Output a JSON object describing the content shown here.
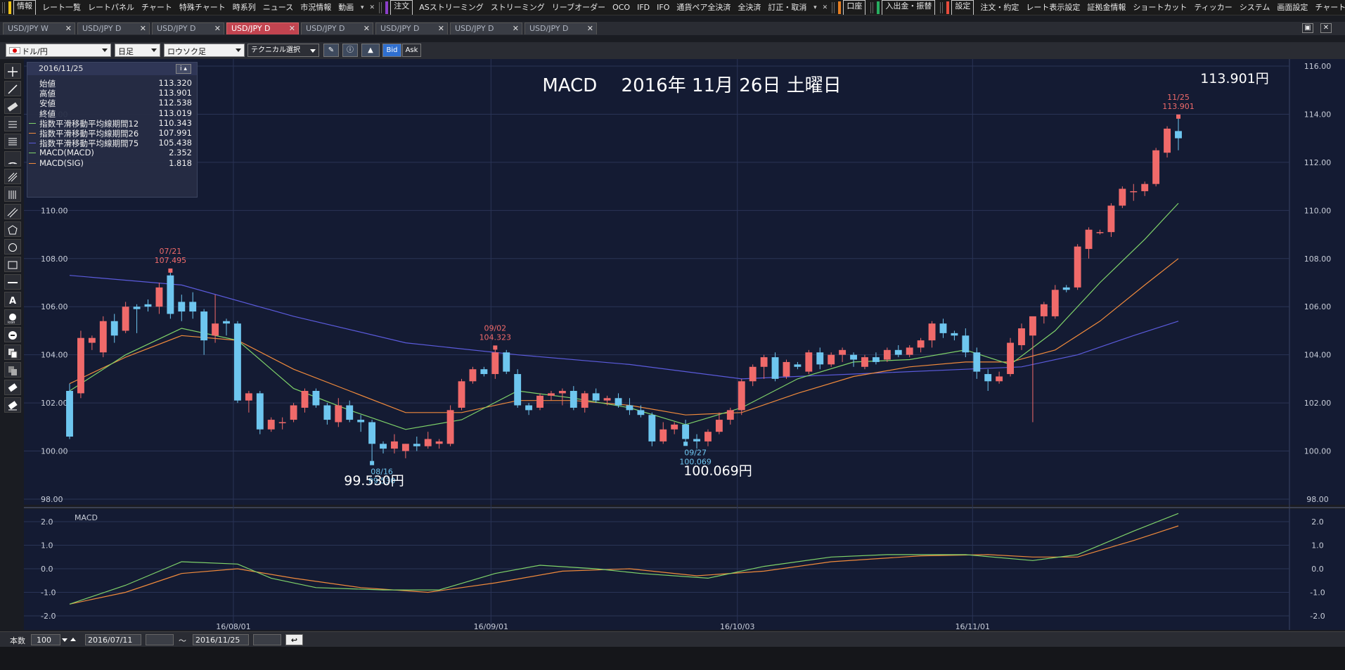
{
  "menu": {
    "groups": [
      {
        "color": "#f0c419",
        "items": [
          "情報",
          "レート一覧",
          "レートパネル",
          "チャート",
          "特殊チャート",
          "時系列",
          "ニュース",
          "市況情報",
          "動画"
        ]
      },
      {
        "color": "#8b3fc9",
        "items": [
          "注文",
          "ASストリーミング",
          "ストリーミング",
          "リーブオーダー",
          "OCO",
          "IFD",
          "IFO",
          "通貨ペア全決済",
          "全決済",
          "訂正・取消"
        ]
      },
      {
        "color": "#e67e22",
        "items": [
          "口座"
        ]
      },
      {
        "color": "#27ae60",
        "items": [
          "入出金・振替"
        ]
      },
      {
        "color": "#e74c3c",
        "items": [
          "設定",
          "注文・約定",
          "レート表示設定",
          "証拠金情報",
          "ショートカット",
          "ティッカー",
          "システム",
          "画面設定",
          "チャート"
        ]
      }
    ]
  },
  "tabs": [
    {
      "label": "USD/JPY W",
      "active": false
    },
    {
      "label": "USD/JPY D",
      "active": false
    },
    {
      "label": "USD/JPY D",
      "active": false
    },
    {
      "label": "USD/JPY D",
      "active": true
    },
    {
      "label": "USD/JPY D",
      "active": false
    },
    {
      "label": "USD/JPY D",
      "active": false
    },
    {
      "label": "USD/JPY D",
      "active": false
    },
    {
      "label": "USD/JPY D",
      "active": false
    }
  ],
  "toolbar": {
    "pair": "ドル/円",
    "period": "日足",
    "chart_kind": "ロウソク足",
    "technical": "テクニカル選択",
    "bid": "Bid",
    "ask": "Ask"
  },
  "info_panel": {
    "date": "2016/11/25",
    "rows": [
      {
        "label": "始値",
        "value": "113.320",
        "color": ""
      },
      {
        "label": "高値",
        "value": "113.901",
        "color": ""
      },
      {
        "label": "安値",
        "value": "112.538",
        "color": ""
      },
      {
        "label": "終値",
        "value": "113.019",
        "color": ""
      },
      {
        "label": "指数平滑移動平均線期間12",
        "value": "110.343",
        "color": "#7fd36a"
      },
      {
        "label": "指数平滑移動平均線期間26",
        "value": "107.991",
        "color": "#f08a3c"
      },
      {
        "label": "指数平滑移動平均線期間75",
        "value": "105.438",
        "color": "#5b5bdc"
      },
      {
        "label": "MACD(MACD)",
        "value": "2.352",
        "color": "#7fd36a"
      },
      {
        "label": "MACD(SIG)",
        "value": "1.818",
        "color": "#f08a3c"
      }
    ]
  },
  "annotations": {
    "title": "MACD　 2016年 11月 26日 土曜日",
    "big_labels": [
      "113.901円",
      "99.530円",
      "100.069円"
    ],
    "small_labels": [
      {
        "date": "07/21",
        "price": "107.495",
        "kind": "high"
      },
      {
        "date": "09/02",
        "price": "104.323",
        "kind": "high"
      },
      {
        "date": "11/25",
        "price": "113.901",
        "kind": "high"
      },
      {
        "date": "08/16",
        "price": "99.530",
        "kind": "low"
      },
      {
        "date": "09/27",
        "price": "100.069",
        "kind": "low"
      }
    ],
    "macd_label": "MACD"
  },
  "colors": {
    "up": "#f06a6a",
    "down": "#6ec6ef",
    "ema12": "#7fd36a",
    "ema26": "#f08a3c",
    "ema75": "#5b5bdc",
    "bg": "#141b33",
    "grid": "#2a3456"
  },
  "bottom": {
    "count_label": "本数",
    "count_value": "100",
    "from_date": "2016/07/11",
    "tilde": "～",
    "to_date": "2016/11/25"
  },
  "chart_data": {
    "type": "candlestick",
    "title": "MACD",
    "price_axis": {
      "ticks": [
        "116.00",
        "114.00",
        "112.00",
        "110.00",
        "108.00",
        "106.00",
        "104.00",
        "102.00",
        "100.00",
        "98.00"
      ],
      "ylim": [
        98,
        116
      ]
    },
    "macd_axis": {
      "ticks": [
        "2.0",
        "1.0",
        "0.0",
        "-1.0",
        "-2.0"
      ],
      "ylim": [
        -2.0,
        2.0
      ]
    },
    "x_ticks": [
      "16/08/01",
      "16/09/01",
      "16/10/03",
      "16/11/01"
    ],
    "candles": [
      {
        "o": 102.5,
        "h": 102.8,
        "l": 100.5,
        "c": 100.6
      },
      {
        "o": 102.4,
        "h": 105.0,
        "l": 102.2,
        "c": 104.7
      },
      {
        "o": 104.5,
        "h": 104.8,
        "l": 104.2,
        "c": 104.7
      },
      {
        "o": 104.1,
        "h": 105.6,
        "l": 103.9,
        "c": 105.4
      },
      {
        "o": 105.4,
        "h": 105.7,
        "l": 104.5,
        "c": 104.8
      },
      {
        "o": 105.0,
        "h": 106.2,
        "l": 104.9,
        "c": 106.0
      },
      {
        "o": 106.0,
        "h": 106.1,
        "l": 104.9,
        "c": 105.9
      },
      {
        "o": 106.1,
        "h": 106.3,
        "l": 105.8,
        "c": 106.0
      },
      {
        "o": 106.0,
        "h": 107.0,
        "l": 105.7,
        "c": 106.8
      },
      {
        "o": 107.3,
        "h": 107.5,
        "l": 105.5,
        "c": 105.7
      },
      {
        "o": 106.2,
        "h": 106.5,
        "l": 105.4,
        "c": 105.8
      },
      {
        "o": 106.2,
        "h": 106.6,
        "l": 105.5,
        "c": 105.8
      },
      {
        "o": 105.8,
        "h": 105.9,
        "l": 104.0,
        "c": 104.6
      },
      {
        "o": 104.8,
        "h": 106.5,
        "l": 104.5,
        "c": 105.3
      },
      {
        "o": 105.4,
        "h": 105.5,
        "l": 104.8,
        "c": 105.3
      },
      {
        "o": 105.3,
        "h": 105.4,
        "l": 102.0,
        "c": 102.1
      },
      {
        "o": 102.1,
        "h": 102.5,
        "l": 101.6,
        "c": 102.4
      },
      {
        "o": 102.4,
        "h": 102.5,
        "l": 100.7,
        "c": 100.9
      },
      {
        "o": 100.9,
        "h": 101.4,
        "l": 100.8,
        "c": 101.3
      },
      {
        "o": 101.2,
        "h": 101.4,
        "l": 100.9,
        "c": 101.2
      },
      {
        "o": 101.3,
        "h": 102.0,
        "l": 101.2,
        "c": 101.9
      },
      {
        "o": 101.8,
        "h": 102.6,
        "l": 101.6,
        "c": 102.5
      },
      {
        "o": 102.5,
        "h": 102.6,
        "l": 101.8,
        "c": 101.9
      },
      {
        "o": 101.9,
        "h": 102.0,
        "l": 101.1,
        "c": 101.3
      },
      {
        "o": 101.2,
        "h": 102.2,
        "l": 101.0,
        "c": 101.9
      },
      {
        "o": 101.9,
        "h": 102.1,
        "l": 101.2,
        "c": 101.3
      },
      {
        "o": 101.3,
        "h": 101.5,
        "l": 100.8,
        "c": 101.2
      },
      {
        "o": 101.2,
        "h": 101.3,
        "l": 99.5,
        "c": 100.3
      },
      {
        "o": 100.3,
        "h": 100.4,
        "l": 99.9,
        "c": 100.1
      },
      {
        "o": 100.1,
        "h": 100.7,
        "l": 99.9,
        "c": 100.4
      },
      {
        "o": 100.0,
        "h": 100.3,
        "l": 99.7,
        "c": 100.3
      },
      {
        "o": 100.3,
        "h": 100.6,
        "l": 100.0,
        "c": 100.2
      },
      {
        "o": 100.2,
        "h": 100.8,
        "l": 100.1,
        "c": 100.5
      },
      {
        "o": 100.3,
        "h": 100.5,
        "l": 100.1,
        "c": 100.4
      },
      {
        "o": 100.3,
        "h": 101.9,
        "l": 100.2,
        "c": 101.7
      },
      {
        "o": 101.8,
        "h": 103.0,
        "l": 101.7,
        "c": 102.9
      },
      {
        "o": 102.9,
        "h": 103.5,
        "l": 102.8,
        "c": 103.4
      },
      {
        "o": 103.4,
        "h": 103.5,
        "l": 103.1,
        "c": 103.2
      },
      {
        "o": 103.2,
        "h": 104.3,
        "l": 103.0,
        "c": 104.1
      },
      {
        "o": 104.1,
        "h": 104.2,
        "l": 103.2,
        "c": 103.3
      },
      {
        "o": 103.2,
        "h": 103.4,
        "l": 101.8,
        "c": 101.9
      },
      {
        "o": 101.9,
        "h": 102.0,
        "l": 101.5,
        "c": 101.7
      },
      {
        "o": 101.8,
        "h": 102.4,
        "l": 101.7,
        "c": 102.3
      },
      {
        "o": 102.3,
        "h": 102.5,
        "l": 102.1,
        "c": 102.4
      },
      {
        "o": 102.4,
        "h": 102.6,
        "l": 101.9,
        "c": 102.5
      },
      {
        "o": 102.5,
        "h": 102.7,
        "l": 101.7,
        "c": 101.8
      },
      {
        "o": 101.8,
        "h": 102.5,
        "l": 101.6,
        "c": 102.4
      },
      {
        "o": 102.4,
        "h": 102.6,
        "l": 102.0,
        "c": 102.1
      },
      {
        "o": 102.1,
        "h": 102.3,
        "l": 101.9,
        "c": 102.2
      },
      {
        "o": 102.2,
        "h": 102.4,
        "l": 101.8,
        "c": 101.9
      },
      {
        "o": 101.9,
        "h": 102.2,
        "l": 101.5,
        "c": 101.7
      },
      {
        "o": 101.7,
        "h": 101.9,
        "l": 101.4,
        "c": 101.5
      },
      {
        "o": 101.5,
        "h": 101.6,
        "l": 100.2,
        "c": 100.4
      },
      {
        "o": 100.4,
        "h": 101.2,
        "l": 100.3,
        "c": 100.9
      },
      {
        "o": 100.9,
        "h": 101.2,
        "l": 100.7,
        "c": 101.1
      },
      {
        "o": 101.1,
        "h": 101.3,
        "l": 100.3,
        "c": 100.5
      },
      {
        "o": 100.5,
        "h": 100.7,
        "l": 100.1,
        "c": 100.4
      },
      {
        "o": 100.4,
        "h": 100.9,
        "l": 100.2,
        "c": 100.8
      },
      {
        "o": 100.8,
        "h": 101.6,
        "l": 100.7,
        "c": 101.3
      },
      {
        "o": 101.3,
        "h": 101.8,
        "l": 101.1,
        "c": 101.7
      },
      {
        "o": 101.7,
        "h": 103.0,
        "l": 101.5,
        "c": 102.9
      },
      {
        "o": 102.9,
        "h": 103.6,
        "l": 102.7,
        "c": 103.5
      },
      {
        "o": 103.5,
        "h": 104.0,
        "l": 103.0,
        "c": 103.9
      },
      {
        "o": 103.9,
        "h": 104.1,
        "l": 102.9,
        "c": 103.0
      },
      {
        "o": 103.1,
        "h": 103.8,
        "l": 103.0,
        "c": 103.7
      },
      {
        "o": 103.6,
        "h": 103.7,
        "l": 103.4,
        "c": 103.5
      },
      {
        "o": 103.3,
        "h": 104.2,
        "l": 103.2,
        "c": 104.1
      },
      {
        "o": 104.1,
        "h": 104.3,
        "l": 103.4,
        "c": 103.6
      },
      {
        "o": 103.6,
        "h": 104.1,
        "l": 103.5,
        "c": 104.0
      },
      {
        "o": 104.0,
        "h": 104.3,
        "l": 103.7,
        "c": 104.2
      },
      {
        "o": 104.0,
        "h": 104.1,
        "l": 103.5,
        "c": 103.8
      },
      {
        "o": 103.5,
        "h": 104.0,
        "l": 103.4,
        "c": 103.9
      },
      {
        "o": 103.9,
        "h": 104.1,
        "l": 103.6,
        "c": 103.7
      },
      {
        "o": 103.8,
        "h": 104.3,
        "l": 103.7,
        "c": 104.2
      },
      {
        "o": 104.2,
        "h": 104.4,
        "l": 103.9,
        "c": 104.0
      },
      {
        "o": 104.0,
        "h": 104.4,
        "l": 103.9,
        "c": 104.3
      },
      {
        "o": 104.3,
        "h": 104.7,
        "l": 104.1,
        "c": 104.6
      },
      {
        "o": 104.6,
        "h": 105.4,
        "l": 104.3,
        "c": 105.3
      },
      {
        "o": 105.3,
        "h": 105.5,
        "l": 104.7,
        "c": 104.9
      },
      {
        "o": 104.9,
        "h": 105.0,
        "l": 104.6,
        "c": 104.8
      },
      {
        "o": 104.8,
        "h": 105.1,
        "l": 103.9,
        "c": 104.1
      },
      {
        "o": 104.1,
        "h": 104.3,
        "l": 103.0,
        "c": 103.3
      },
      {
        "o": 103.2,
        "h": 103.4,
        "l": 102.5,
        "c": 102.9
      },
      {
        "o": 102.9,
        "h": 103.3,
        "l": 102.8,
        "c": 103.1
      },
      {
        "o": 103.2,
        "h": 104.7,
        "l": 103.1,
        "c": 104.5
      },
      {
        "o": 104.4,
        "h": 105.3,
        "l": 104.2,
        "c": 105.1
      },
      {
        "o": 104.8,
        "h": 105.3,
        "l": 101.2,
        "c": 105.6
      },
      {
        "o": 105.6,
        "h": 106.2,
        "l": 105.3,
        "c": 106.1
      },
      {
        "o": 105.6,
        "h": 106.9,
        "l": 105.5,
        "c": 106.7
      },
      {
        "o": 106.8,
        "h": 106.9,
        "l": 106.6,
        "c": 106.7
      },
      {
        "o": 106.8,
        "h": 108.6,
        "l": 106.7,
        "c": 108.5
      },
      {
        "o": 108.4,
        "h": 109.3,
        "l": 108.0,
        "c": 109.2
      },
      {
        "o": 109.1,
        "h": 109.2,
        "l": 109.0,
        "c": 109.1
      },
      {
        "o": 109.1,
        "h": 110.3,
        "l": 108.9,
        "c": 110.2
      },
      {
        "o": 110.2,
        "h": 111.0,
        "l": 110.1,
        "c": 110.9
      },
      {
        "o": 110.8,
        "h": 111.1,
        "l": 110.4,
        "c": 110.8
      },
      {
        "o": 110.8,
        "h": 111.2,
        "l": 110.6,
        "c": 111.1
      },
      {
        "o": 111.1,
        "h": 112.6,
        "l": 111.0,
        "c": 112.5
      },
      {
        "o": 112.4,
        "h": 113.5,
        "l": 112.2,
        "c": 113.4
      },
      {
        "o": 113.3,
        "h": 113.9,
        "l": 112.5,
        "c": 113.0
      }
    ],
    "ema12": [
      [
        0,
        102.5
      ],
      [
        5,
        104.0
      ],
      [
        10,
        105.1
      ],
      [
        15,
        104.6
      ],
      [
        20,
        102.6
      ],
      [
        25,
        101.7
      ],
      [
        30,
        100.9
      ],
      [
        35,
        101.3
      ],
      [
        40,
        102.5
      ],
      [
        45,
        102.2
      ],
      [
        50,
        101.8
      ],
      [
        55,
        101.1
      ],
      [
        60,
        101.8
      ],
      [
        65,
        103.0
      ],
      [
        70,
        103.7
      ],
      [
        75,
        103.8
      ],
      [
        80,
        104.2
      ],
      [
        84,
        103.6
      ],
      [
        88,
        105.0
      ],
      [
        92,
        107.0
      ],
      [
        96,
        108.8
      ],
      [
        99,
        110.3
      ]
    ],
    "ema26": [
      [
        0,
        102.8
      ],
      [
        5,
        103.9
      ],
      [
        10,
        104.8
      ],
      [
        15,
        104.6
      ],
      [
        20,
        103.4
      ],
      [
        25,
        102.5
      ],
      [
        30,
        101.6
      ],
      [
        35,
        101.6
      ],
      [
        40,
        102.1
      ],
      [
        45,
        102.1
      ],
      [
        50,
        101.9
      ],
      [
        55,
        101.5
      ],
      [
        60,
        101.6
      ],
      [
        65,
        102.4
      ],
      [
        70,
        103.1
      ],
      [
        75,
        103.5
      ],
      [
        80,
        103.7
      ],
      [
        84,
        103.7
      ],
      [
        88,
        104.2
      ],
      [
        92,
        105.4
      ],
      [
        96,
        106.9
      ],
      [
        99,
        108.0
      ]
    ],
    "ema75": [
      [
        0,
        107.3
      ],
      [
        10,
        106.9
      ],
      [
        20,
        105.6
      ],
      [
        30,
        104.5
      ],
      [
        40,
        104.0
      ],
      [
        50,
        103.6
      ],
      [
        60,
        103.0
      ],
      [
        70,
        103.2
      ],
      [
        80,
        103.4
      ],
      [
        85,
        103.5
      ],
      [
        90,
        104.0
      ],
      [
        95,
        104.8
      ],
      [
        99,
        105.4
      ]
    ],
    "macd": [
      [
        0,
        -1.5
      ],
      [
        5,
        -0.7
      ],
      [
        10,
        0.3
      ],
      [
        15,
        0.2
      ],
      [
        18,
        -0.4
      ],
      [
        22,
        -0.8
      ],
      [
        28,
        -0.9
      ],
      [
        33,
        -0.9
      ],
      [
        38,
        -0.2
      ],
      [
        42,
        0.15
      ],
      [
        47,
        0.0
      ],
      [
        51,
        -0.2
      ],
      [
        57,
        -0.4
      ],
      [
        62,
        0.1
      ],
      [
        68,
        0.5
      ],
      [
        73,
        0.6
      ],
      [
        80,
        0.6
      ],
      [
        86,
        0.35
      ],
      [
        90,
        0.6
      ],
      [
        95,
        1.6
      ],
      [
        99,
        2.35
      ]
    ],
    "macd_sig": [
      [
        0,
        -1.5
      ],
      [
        5,
        -1.0
      ],
      [
        10,
        -0.2
      ],
      [
        15,
        0.0
      ],
      [
        20,
        -0.4
      ],
      [
        26,
        -0.8
      ],
      [
        32,
        -1.0
      ],
      [
        38,
        -0.6
      ],
      [
        44,
        -0.1
      ],
      [
        50,
        0.0
      ],
      [
        56,
        -0.3
      ],
      [
        62,
        -0.1
      ],
      [
        68,
        0.3
      ],
      [
        76,
        0.55
      ],
      [
        82,
        0.6
      ],
      [
        86,
        0.5
      ],
      [
        90,
        0.5
      ],
      [
        95,
        1.2
      ],
      [
        99,
        1.82
      ]
    ]
  }
}
